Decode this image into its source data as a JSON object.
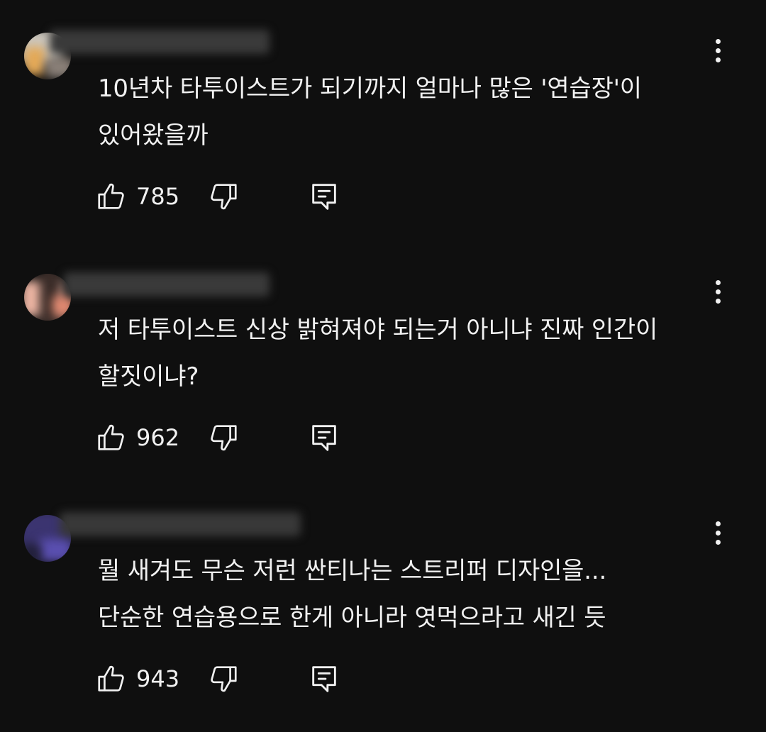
{
  "comments": [
    {
      "lines": [
        "10년차 타투이스트가 되기까지 얼마나 많은 '연습장'이",
        "있어왔을까"
      ],
      "likes": "785",
      "avatar_colors": [
        "#c9c2b8",
        "#e6a955",
        "#7a6f66"
      ]
    },
    {
      "lines": [
        "저 타투이스트 신상 밝혀져야 되는거 아니냐 진짜 인간이",
        "할짓이냐?"
      ],
      "likes": "962",
      "avatar_colors": [
        "#f2b8a8",
        "#3a2e2a",
        "#e08a70"
      ]
    },
    {
      "lines": [
        "뭘 새겨도 무슨 저런 싼티나는 스트리퍼 디자인을...",
        "단순한 연습용으로 한게 아니라 엿먹으라고 새긴 듯"
      ],
      "likes": "943",
      "avatar_colors": [
        "#3b3470",
        "#5a4fb0",
        "#2a2550"
      ]
    }
  ],
  "icons": {
    "like": "thumbs-up-icon",
    "dislike": "thumbs-down-icon",
    "reply": "reply-comment-icon",
    "more": "more-vertical-icon"
  },
  "colors": {
    "background": "#0f0f0f",
    "text": "#f1f1f1"
  }
}
